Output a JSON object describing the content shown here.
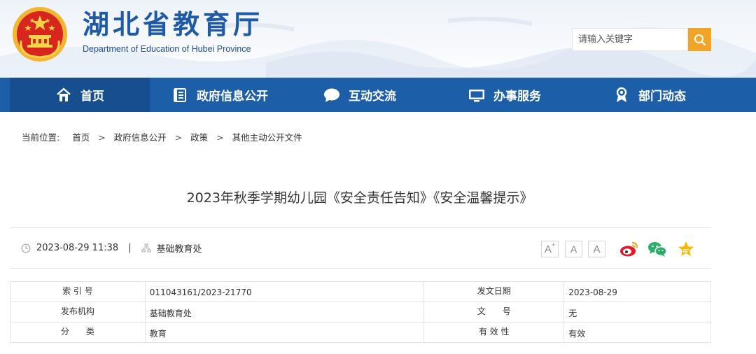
{
  "site": {
    "title": "湖北省教育厅",
    "subtitle": "Department of Education of Hubei Province"
  },
  "search": {
    "placeholder": "请输入关键字",
    "icon": "search-icon"
  },
  "nav": {
    "items": [
      {
        "label": "首页",
        "icon": "home-icon",
        "active": true
      },
      {
        "label": "政府信息公开",
        "icon": "document-icon"
      },
      {
        "label": "互动交流",
        "icon": "chat-bubble-icon"
      },
      {
        "label": "办事服务",
        "icon": "monitor-icon"
      },
      {
        "label": "部门动态",
        "icon": "person-badge-icon"
      }
    ]
  },
  "breadcrumb": {
    "label": "当前位置:",
    "items": [
      "首页",
      "政府信息公开",
      "政策",
      "其他主动公开文件"
    ],
    "separator": ">"
  },
  "article": {
    "title": "2023年秋季学期幼儿园《安全责任告知》《安全温馨提示》",
    "datetime": "2023-08-29 11:38",
    "divider": "|",
    "source": "基础教育处"
  },
  "font_size": {
    "large": "A",
    "large_sup": "+",
    "medium": "A",
    "small": "A"
  },
  "share": [
    "weibo-icon",
    "wechat-icon",
    "favorite-star-icon"
  ],
  "info": {
    "rows": [
      {
        "k1": "索 引 号",
        "v1": "011043161/2023-21770",
        "k2": "发文日期",
        "v2": "2023-08-29"
      },
      {
        "k1": "发布机构",
        "v1": "基础教育处",
        "k2": "文　　号",
        "v2": "无"
      },
      {
        "k1": "分　　类",
        "v1": "教育",
        "k2": "有 效 性",
        "v2": "有效"
      }
    ]
  },
  "colors": {
    "brand_blue": "#1d5ea8",
    "nav_active": "#174e8f",
    "title_blue": "#1f5aa6",
    "search_orange": "#f0a528",
    "emblem_red": "#d7261e",
    "emblem_gold": "#f2b632"
  }
}
